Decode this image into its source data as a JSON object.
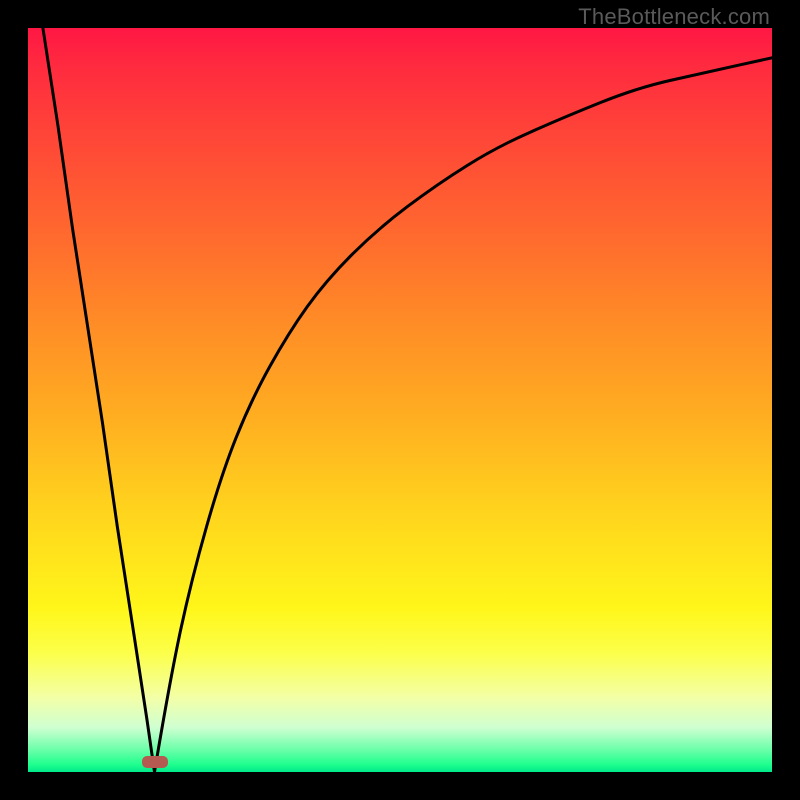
{
  "attribution": "TheBottleneck.com",
  "chart_data": {
    "type": "line",
    "title": "",
    "xlabel": "",
    "ylabel": "",
    "xlim": [
      0,
      100
    ],
    "ylim": [
      0,
      100
    ],
    "series": [
      {
        "name": "left-branch",
        "x": [
          2,
          4,
          6,
          8,
          10,
          12,
          14,
          16,
          17
        ],
        "values": [
          100,
          87,
          73,
          60,
          47,
          33,
          20,
          7,
          0
        ]
      },
      {
        "name": "right-branch",
        "x": [
          17,
          19,
          22,
          26,
          30,
          35,
          40,
          47,
          55,
          63,
          72,
          82,
          91,
          100
        ],
        "values": [
          0,
          12,
          26,
          40,
          50,
          59,
          66,
          73,
          79,
          84,
          88,
          92,
          94,
          96
        ]
      }
    ],
    "marker": {
      "x": 17,
      "y": 1.3,
      "color": "#b45a50"
    },
    "gradient_stops": [
      {
        "pct": 0,
        "color": "#ff1744"
      },
      {
        "pct": 100,
        "color": "#00e98b"
      }
    ],
    "grid": false,
    "legend_position": "none"
  },
  "dimensions": {
    "plot_left": 28,
    "plot_top": 28,
    "plot_size": 744
  }
}
